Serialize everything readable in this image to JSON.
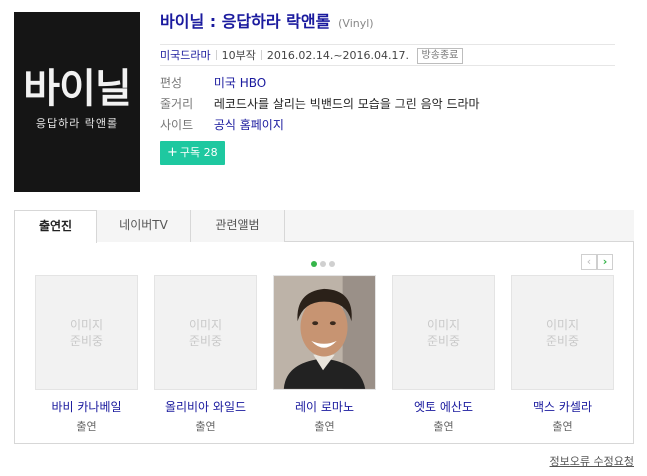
{
  "poster": {
    "logo_main": "바이닐",
    "logo_sub": "응답하라 락앤롤"
  },
  "header": {
    "title": "바이닐 : 응답하라 락앤롤",
    "original_title": "(Vinyl)"
  },
  "meta": {
    "genre": "미국드라마",
    "episodes": "10부작",
    "airing": "2016.02.14.~2016.04.17.",
    "status": "방송종료"
  },
  "details": [
    {
      "key": "편성",
      "value": "미국 HBO",
      "link": true
    },
    {
      "key": "줄거리",
      "value": "레코드사를 살리는 빅밴드의 모습을 그린 음악 드라마",
      "link": false
    },
    {
      "key": "사이트",
      "value": "공식 홈페이지",
      "link": true
    }
  ],
  "subscribe": {
    "label": "구독",
    "count": "28",
    "color": "#1ec8a0"
  },
  "tabs": [
    {
      "label": "출연진",
      "active": true
    },
    {
      "label": "네이버TV",
      "active": false
    },
    {
      "label": "관련앨범",
      "active": false
    }
  ],
  "pager": {
    "pages": 3,
    "current": 1,
    "prev_icon": "chevron-left-icon",
    "next_icon": "chevron-right-icon"
  },
  "no_image_text": [
    "이미지",
    "준비중"
  ],
  "cast": [
    {
      "name": "바비 카나베일",
      "role": "출연",
      "has_photo": false
    },
    {
      "name": "올리비아 와일드",
      "role": "출연",
      "has_photo": false
    },
    {
      "name": "레이 로마노",
      "role": "출연",
      "has_photo": true
    },
    {
      "name": "엣토 에산도",
      "role": "출연",
      "has_photo": false
    },
    {
      "name": "맥스 카셀라",
      "role": "출연",
      "has_photo": false
    }
  ],
  "footer": {
    "report_link": "정보오류 수정요청"
  },
  "colors": {
    "link": "#1a1a9e",
    "accent_green": "#36b54a",
    "poster_bg": "#151515"
  }
}
